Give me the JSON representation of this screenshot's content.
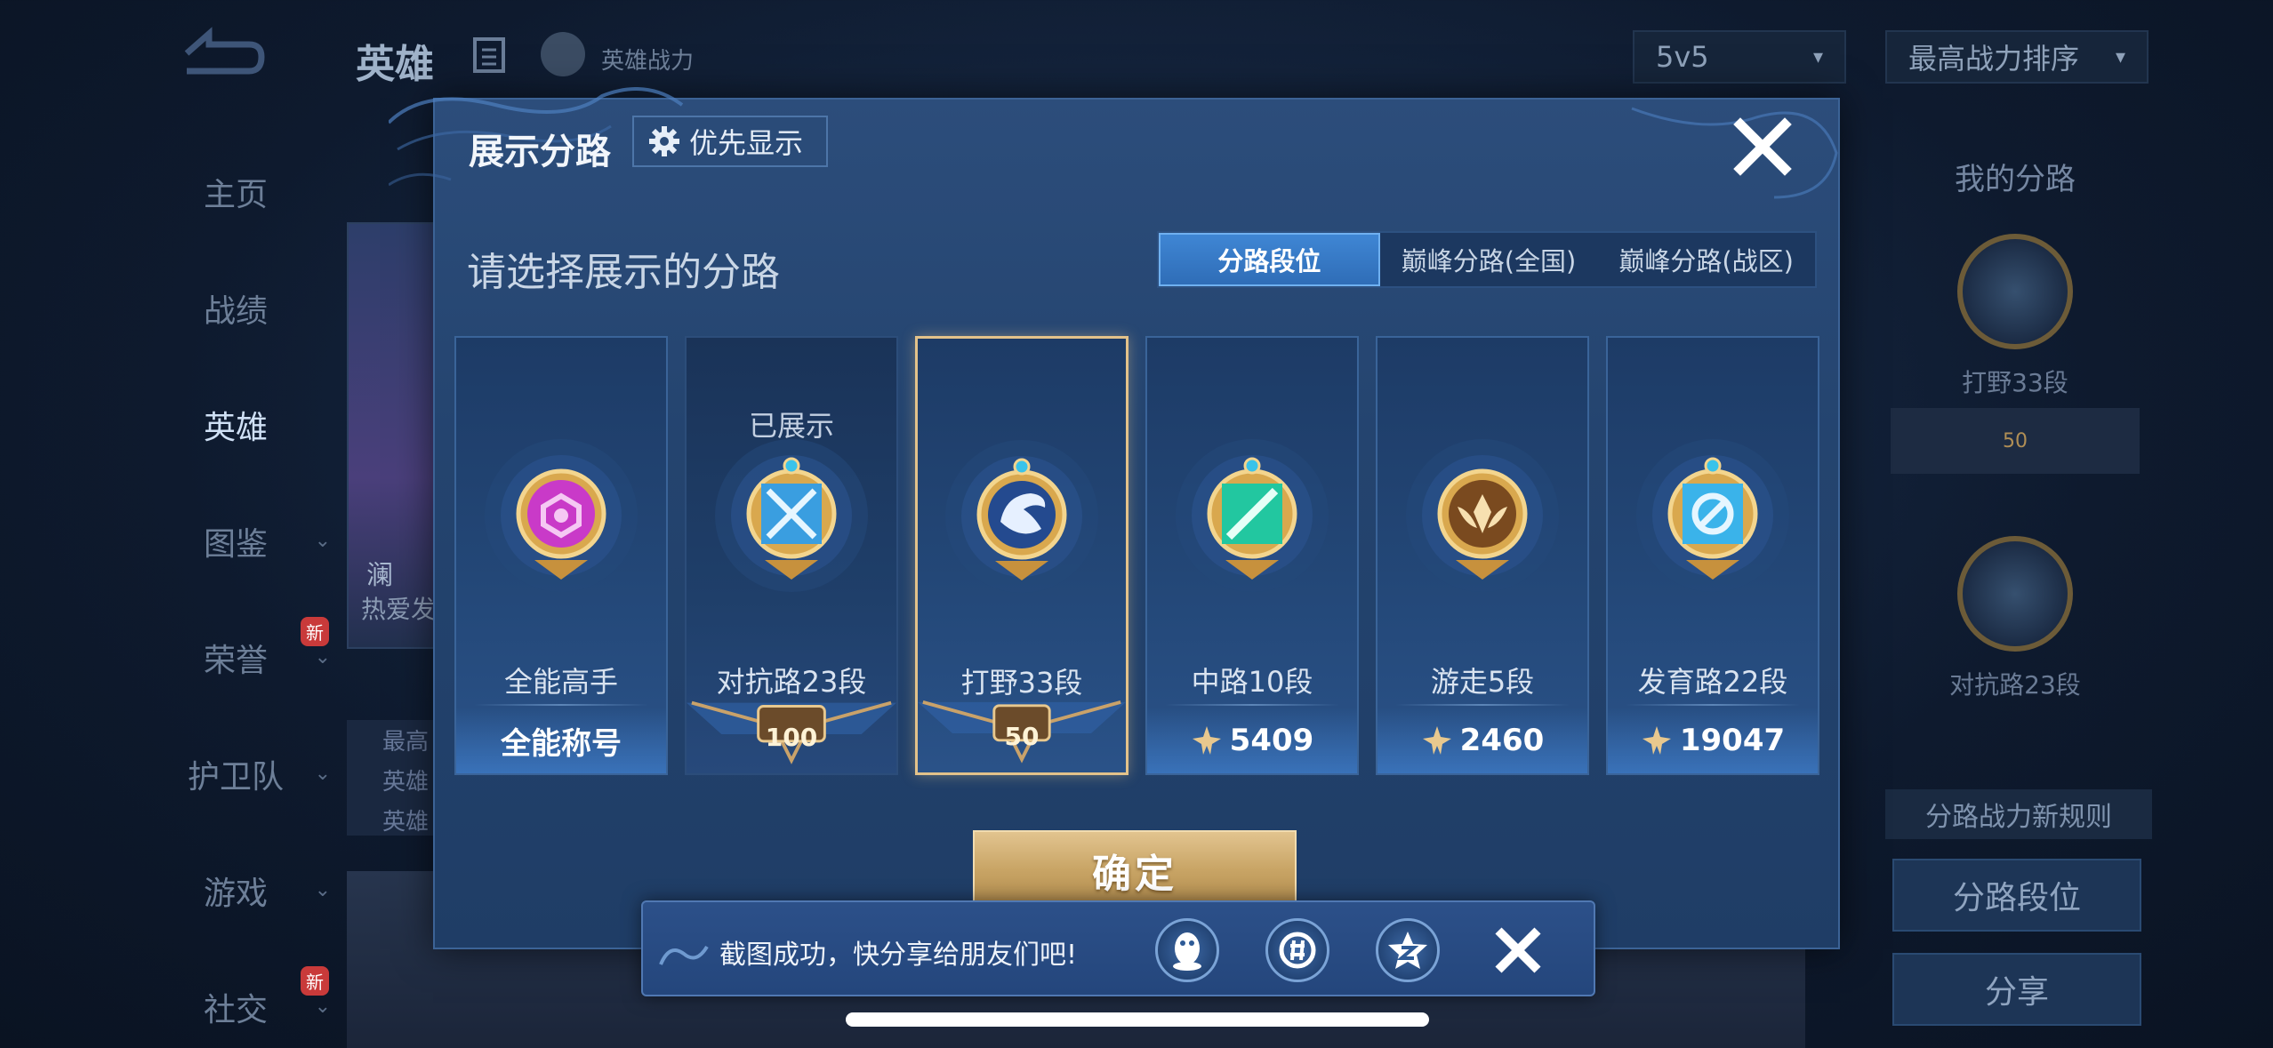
{
  "background": {
    "top_title": "英雄",
    "top_subtitle": "英雄战力",
    "mode_select": "5v5",
    "sort_select": "最高战力排序",
    "sidebar": [
      {
        "label": "主页"
      },
      {
        "label": "战绩"
      },
      {
        "label": "英雄"
      },
      {
        "label": "图鉴"
      },
      {
        "label": "荣誉",
        "badge": "新"
      },
      {
        "label": "护卫队"
      },
      {
        "label": "游戏"
      },
      {
        "label": "社交",
        "badge": "新"
      }
    ],
    "hero_card": {
      "name": "澜",
      "subtitle": "热爱发"
    },
    "hero_info_lines": [
      "最高",
      "英雄",
      "英雄"
    ],
    "right_panel": {
      "title": "我的分路",
      "badge1_label": "打野33段",
      "badge1_tag": "50",
      "badge2_label": "对抗路23段",
      "note": "分路战力新规则",
      "btn_segment": "分路段位",
      "btn_share": "分享"
    }
  },
  "modal": {
    "title": "展示分路",
    "priority_button": "优先显示",
    "subtitle": "请选择展示的分路",
    "tabs": [
      {
        "label": "分路段位",
        "active": true
      },
      {
        "label": "巅峰分路(全国)",
        "active": false
      },
      {
        "label": "巅峰分路(战区)",
        "active": false
      }
    ],
    "cards": [
      {
        "name": "全能高手",
        "footer": "全能称号",
        "emblem": "all-round-emblem-icon",
        "color": "#c93ac8"
      },
      {
        "name": "对抗路23段",
        "tag": "已展示",
        "rank_plate": "100",
        "emblem": "clash-lane-emblem-icon",
        "color": "#3a9ee0"
      },
      {
        "name": "打野33段",
        "rank_plate": "50",
        "emblem": "jungle-dragon-emblem-icon",
        "color": "#3b6fc9",
        "selected": true
      },
      {
        "name": "中路10段",
        "points": "5409",
        "emblem": "mid-lane-emblem-icon",
        "color": "#22c7a0"
      },
      {
        "name": "游走5段",
        "points": "2460",
        "emblem": "roam-wings-emblem-icon",
        "color": "#d99a3c"
      },
      {
        "name": "发育路22段",
        "points": "19047",
        "emblem": "farm-lane-emblem-icon",
        "color": "#3ab3ea"
      }
    ],
    "confirm_button": "确定"
  },
  "toast": {
    "text": "截图成功，快分享给朋友们吧!",
    "share_targets": [
      "qq-icon",
      "wechat-moments-icon",
      "qzone-icon"
    ]
  }
}
